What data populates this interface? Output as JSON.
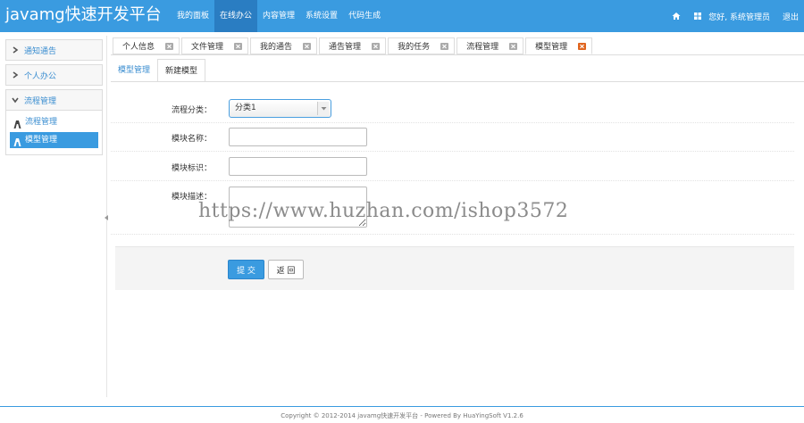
{
  "app": {
    "title": "javamg快速开发平台"
  },
  "topnav": [
    {
      "label": "我的面板",
      "active": false
    },
    {
      "label": "在线办公",
      "active": true
    },
    {
      "label": "内容管理",
      "active": false
    },
    {
      "label": "系统设置",
      "active": false
    },
    {
      "label": "代码生成",
      "active": false
    }
  ],
  "header": {
    "greeting": "您好, 系统管理员",
    "logout": "退出",
    "icons": [
      "home-icon",
      "grid-icon"
    ]
  },
  "sidebar": {
    "groups": [
      {
        "label": "通知通告",
        "icon": "chevron-right-icon"
      },
      {
        "label": "个人办公",
        "icon": "chevron-right-icon"
      },
      {
        "label": "流程管理",
        "icon": "chevron-down-icon"
      }
    ],
    "items": [
      {
        "label": "流程管理",
        "active": false
      },
      {
        "label": "模型管理",
        "active": true
      }
    ]
  },
  "tabs": [
    {
      "label": "个人信息"
    },
    {
      "label": "文件管理"
    },
    {
      "label": "我的通告"
    },
    {
      "label": "通告管理"
    },
    {
      "label": "我的任务"
    },
    {
      "label": "流程管理"
    },
    {
      "label": "模型管理",
      "active": true
    }
  ],
  "subtabs": [
    {
      "label": "模型管理",
      "active": false
    },
    {
      "label": "新建模型",
      "active": true
    }
  ],
  "form": {
    "category_label": "流程分类：",
    "category_value": "分类1",
    "name_label": "模块名称：",
    "name_value": "",
    "key_label": "模块标识：",
    "key_value": "",
    "desc_label": "模块描述：",
    "desc_value": ""
  },
  "actions": {
    "submit": "提 交",
    "back": "返 回"
  },
  "watermark": "https://www.huzhan.com/ishop3572",
  "footer": {
    "text": "Copyright © 2012-2014 javamg快速开发平台 - Powered By HuaYingSoft V1.2.6"
  },
  "colors": {
    "primary": "#3a9be0",
    "nav_active": "#2a7dc2",
    "link": "#3a8dd0",
    "close_badge": "#aaaaaa",
    "close_badge_active": "#e0641e"
  }
}
